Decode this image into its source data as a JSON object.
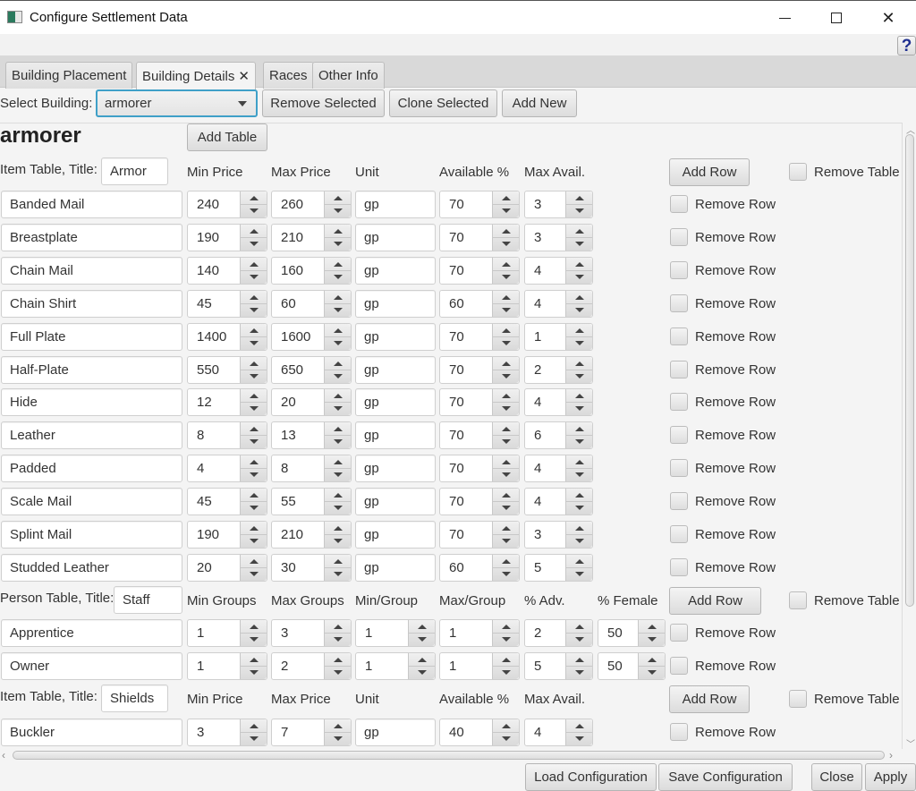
{
  "window": {
    "title": "Configure Settlement Data",
    "minimize_label": "minimize",
    "maximize_label": "maximize",
    "close_label": "close",
    "help_label": "?"
  },
  "tabs": [
    {
      "label": "Building Placement",
      "active": false
    },
    {
      "label": "Building Details",
      "active": true,
      "closable": true,
      "close_glyph": "✕"
    },
    {
      "label": "Races",
      "active": false
    },
    {
      "label": "Other Info",
      "active": false
    }
  ],
  "toolbar": {
    "select_label": "Select Building:",
    "selected_building": "armorer",
    "remove_selected": "Remove Selected",
    "clone_selected": "Clone Selected",
    "add_new": "Add New"
  },
  "building": {
    "name": "armorer",
    "add_table": "Add Table"
  },
  "tables": [
    {
      "type_label": "Item Table, Title:",
      "title": "Armor",
      "columns": [
        "Min Price",
        "Max Price",
        "Unit",
        "Available %",
        "Max Avail."
      ],
      "add_row": "Add Row",
      "remove_table": "Remove Table",
      "remove_row": "Remove Row",
      "rows": [
        {
          "name": "Banded Mail",
          "min": "240",
          "max": "260",
          "unit": "gp",
          "avail": "70",
          "maxavail": "3"
        },
        {
          "name": "Breastplate",
          "min": "190",
          "max": "210",
          "unit": "gp",
          "avail": "70",
          "maxavail": "3"
        },
        {
          "name": "Chain Mail",
          "min": "140",
          "max": "160",
          "unit": "gp",
          "avail": "70",
          "maxavail": "4"
        },
        {
          "name": "Chain Shirt",
          "min": "45",
          "max": "60",
          "unit": "gp",
          "avail": "60",
          "maxavail": "4"
        },
        {
          "name": "Full Plate",
          "min": "1400",
          "max": "1600",
          "unit": "gp",
          "avail": "70",
          "maxavail": "1"
        },
        {
          "name": "Half-Plate",
          "min": "550",
          "max": "650",
          "unit": "gp",
          "avail": "70",
          "maxavail": "2"
        },
        {
          "name": "Hide",
          "min": "12",
          "max": "20",
          "unit": "gp",
          "avail": "70",
          "maxavail": "4"
        },
        {
          "name": "Leather",
          "min": "8",
          "max": "13",
          "unit": "gp",
          "avail": "70",
          "maxavail": "6"
        },
        {
          "name": "Padded",
          "min": "4",
          "max": "8",
          "unit": "gp",
          "avail": "70",
          "maxavail": "4"
        },
        {
          "name": "Scale Mail",
          "min": "45",
          "max": "55",
          "unit": "gp",
          "avail": "70",
          "maxavail": "4"
        },
        {
          "name": "Splint Mail",
          "min": "190",
          "max": "210",
          "unit": "gp",
          "avail": "70",
          "maxavail": "3"
        },
        {
          "name": "Studded Leather",
          "min": "20",
          "max": "30",
          "unit": "gp",
          "avail": "60",
          "maxavail": "5"
        }
      ]
    },
    {
      "type_label": "Person Table, Title:",
      "title": "Staff",
      "columns": [
        "Min Groups",
        "Max Groups",
        "Min/Group",
        "Max/Group",
        "% Adv.",
        "% Female"
      ],
      "add_row": "Add Row",
      "remove_table": "Remove Table",
      "remove_row": "Remove Row",
      "rows": [
        {
          "name": "Apprentice",
          "mingroups": "1",
          "maxgroups": "3",
          "minpergroup": "1",
          "maxpergroup": "1",
          "adv": "2",
          "female": "50"
        },
        {
          "name": "Owner",
          "mingroups": "1",
          "maxgroups": "2",
          "minpergroup": "1",
          "maxpergroup": "1",
          "adv": "5",
          "female": "50"
        }
      ]
    },
    {
      "type_label": "Item Table, Title:",
      "title": "Shields",
      "columns": [
        "Min Price",
        "Max Price",
        "Unit",
        "Available %",
        "Max Avail."
      ],
      "add_row": "Add Row",
      "remove_table": "Remove Table",
      "remove_row": "Remove Row",
      "rows": [
        {
          "name": "Buckler",
          "min": "3",
          "max": "7",
          "unit": "gp",
          "avail": "40",
          "maxavail": "4"
        }
      ]
    }
  ],
  "footer": {
    "load": "Load Configuration",
    "save": "Save Configuration",
    "close": "Close",
    "apply": "Apply"
  }
}
